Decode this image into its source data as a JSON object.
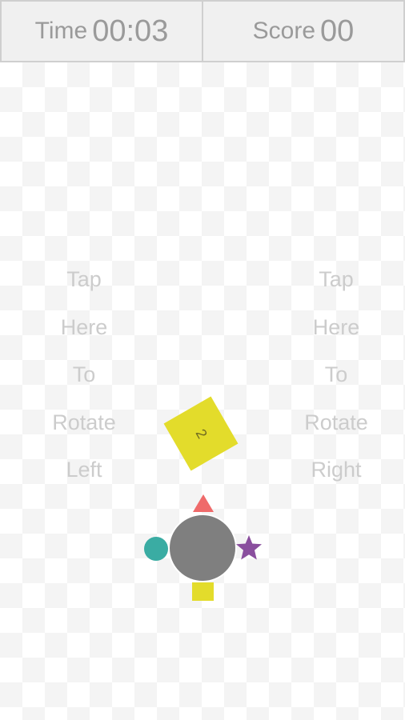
{
  "hud": {
    "time_label": "Time",
    "time_value": "00:03",
    "score_label": "Score",
    "score_value": "00"
  },
  "controls": {
    "left": [
      "Tap",
      "Here",
      "To",
      "Rotate",
      "Left"
    ],
    "right": [
      "Tap",
      "Here",
      "To",
      "Rotate",
      "Right"
    ]
  },
  "falling_block": {
    "number": "2",
    "color": "#e3dc2b"
  },
  "player": {
    "core_color": "#7f7f7f",
    "shapes": [
      {
        "name": "triangle",
        "color": "#ef6a6a"
      },
      {
        "name": "circle",
        "color": "#3aaca3"
      },
      {
        "name": "square",
        "color": "#e3dc2b"
      },
      {
        "name": "star",
        "color": "#8a4f9e"
      }
    ]
  }
}
